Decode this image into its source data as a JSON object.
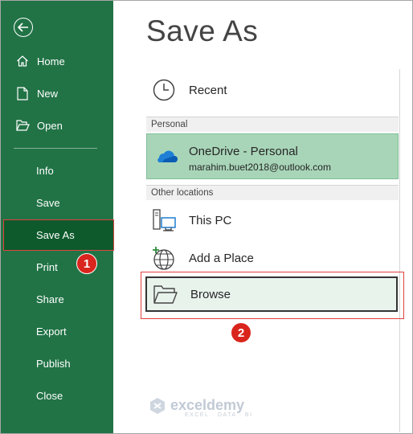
{
  "sidebar": {
    "items": [
      {
        "label": "Home",
        "icon": "home-icon"
      },
      {
        "label": "New",
        "icon": "new-document-icon"
      },
      {
        "label": "Open",
        "icon": "folder-open-icon"
      },
      {
        "label": "Info"
      },
      {
        "label": "Save"
      },
      {
        "label": "Save As"
      },
      {
        "label": "Print"
      },
      {
        "label": "Share"
      },
      {
        "label": "Export"
      },
      {
        "label": "Publish"
      },
      {
        "label": "Close"
      }
    ]
  },
  "main": {
    "title": "Save As",
    "recent_label": "Recent",
    "personal_header": "Personal",
    "onedrive": {
      "name": "OneDrive - Personal",
      "email": "marahim.buet2018@outlook.com"
    },
    "other_header": "Other locations",
    "this_pc_label": "This PC",
    "add_place_label": "Add a Place",
    "browse_label": "Browse"
  },
  "annotations": {
    "step1": "1",
    "step2": "2"
  },
  "watermark": {
    "brand": "exceldemy",
    "tagline": "EXCEL · DATA · BI"
  },
  "colors": {
    "sidebar": "#217346",
    "active": "#0e5a2c",
    "highlight": "#e0413d",
    "onedrive_bg": "#a8d5b8"
  }
}
